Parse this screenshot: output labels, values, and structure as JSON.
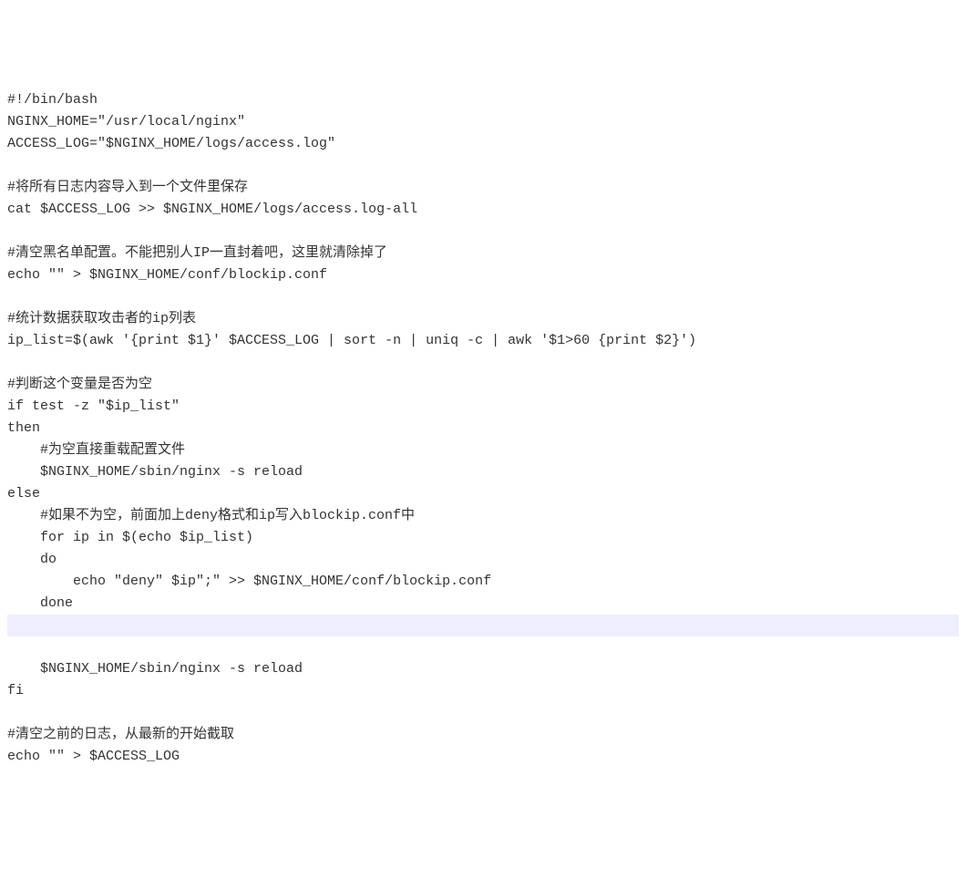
{
  "lines": [
    "#!/bin/bash",
    "NGINX_HOME=\"/usr/local/nginx\"",
    "ACCESS_LOG=\"$NGINX_HOME/logs/access.log\"",
    "",
    "#将所有日志内容导入到一个文件里保存",
    "cat $ACCESS_LOG >> $NGINX_HOME/logs/access.log-all",
    "",
    "#清空黑名单配置。不能把别人IP一直封着吧，这里就清除掉了",
    "echo \"\" > $NGINX_HOME/conf/blockip.conf",
    "",
    "#统计数据获取攻击者的ip列表",
    "ip_list=$(awk '{print $1}' $ACCESS_LOG | sort -n | uniq -c | awk '$1>60 {print $2}')",
    "",
    "#判断这个变量是否为空",
    "if test -z \"$ip_list\"",
    "then",
    "    #为空直接重载配置文件",
    "    $NGINX_HOME/sbin/nginx -s reload",
    "else",
    "    #如果不为空，前面加上deny格式和ip写入blockip.conf中",
    "    for ip in $(echo $ip_list)",
    "    do",
    "        echo \"deny\" $ip\";\" >> $NGINX_HOME/conf/blockip.conf",
    "    done",
    "",
    "",
    "    $NGINX_HOME/sbin/nginx -s reload",
    "fi",
    "",
    "#清空之前的日志，从最新的开始截取",
    "echo \"\" > $ACCESS_LOG"
  ],
  "highlighted_index": 24
}
